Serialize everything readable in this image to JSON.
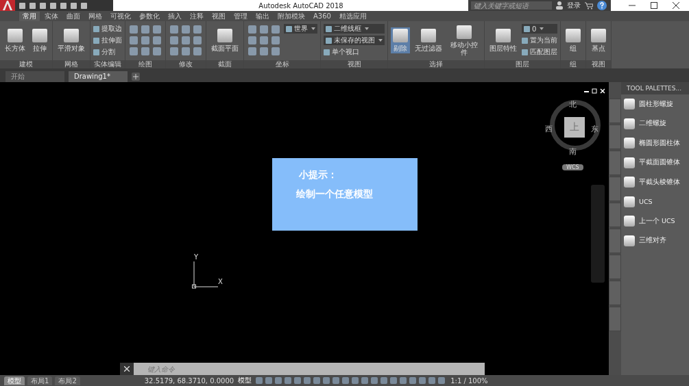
{
  "window": {
    "title": "Autodesk AutoCAD 2018",
    "search_placeholder": "键入关键字或短语",
    "login": "登录"
  },
  "ribbon_tabs": [
    {
      "label": "常用",
      "selected": true
    },
    {
      "label": "实体",
      "selected": false
    },
    {
      "label": "曲面",
      "selected": false
    },
    {
      "label": "网格",
      "selected": false
    },
    {
      "label": "可视化",
      "selected": false
    },
    {
      "label": "参数化",
      "selected": false
    },
    {
      "label": "插入",
      "selected": false
    },
    {
      "label": "注释",
      "selected": false
    },
    {
      "label": "视图",
      "selected": false
    },
    {
      "label": "管理",
      "selected": false
    },
    {
      "label": "输出",
      "selected": false
    },
    {
      "label": "附加模块",
      "selected": false
    },
    {
      "label": "A360",
      "selected": false
    },
    {
      "label": "精选应用",
      "selected": false
    }
  ],
  "ribbon_panels": [
    {
      "title": "建模",
      "items": [
        {
          "kind": "large",
          "label": "长方体"
        },
        {
          "kind": "large",
          "label": "拉伸"
        }
      ]
    },
    {
      "title": "网格",
      "items": [
        {
          "kind": "large",
          "label": "平滑对象"
        }
      ]
    },
    {
      "title": "实体编辑",
      "items": [
        {
          "kind": "small",
          "label": "提取边"
        },
        {
          "kind": "small",
          "label": "拉伸面"
        },
        {
          "kind": "small",
          "label": "分割"
        }
      ]
    },
    {
      "title": "绘图",
      "items": [
        {
          "kind": "grid"
        }
      ]
    },
    {
      "title": "修改",
      "items": [
        {
          "kind": "grid"
        }
      ]
    },
    {
      "title": "截面",
      "items": [
        {
          "kind": "large",
          "label": "截面平面"
        }
      ]
    },
    {
      "title": "坐标",
      "items": [
        {
          "kind": "grid"
        },
        {
          "kind": "dropdown",
          "label": "世界"
        }
      ]
    },
    {
      "title": "视图",
      "items": [
        {
          "kind": "dropdown",
          "label": "二维线框"
        },
        {
          "kind": "dropdown",
          "label": "未保存的视图"
        },
        {
          "kind": "small",
          "label": "单个视口"
        }
      ]
    },
    {
      "title": "选择",
      "items": [
        {
          "kind": "large",
          "label": "剔除",
          "active": true
        },
        {
          "kind": "large",
          "label": "无过滤器",
          "active": false
        },
        {
          "kind": "large",
          "label": "移动小控件",
          "active": false
        }
      ]
    },
    {
      "title": "图层",
      "items": [
        {
          "kind": "large",
          "label": "图层特性"
        },
        {
          "kind": "dropdown",
          "label": "0"
        },
        {
          "kind": "small",
          "label": "置为当前"
        },
        {
          "kind": "small",
          "label": "匹配图层"
        }
      ]
    },
    {
      "title": "组",
      "items": [
        {
          "kind": "large",
          "label": "组"
        }
      ]
    },
    {
      "title": "视图",
      "items": [
        {
          "kind": "large",
          "label": "基点"
        }
      ]
    }
  ],
  "file_tabs": [
    {
      "label": "开始",
      "selected": false
    },
    {
      "label": "Drawing1*",
      "selected": true
    }
  ],
  "viewcube": {
    "north": "北",
    "west": "西",
    "face": "上",
    "east": "东",
    "south": "南",
    "ucs_menu": "WCS"
  },
  "hint": {
    "title": "小提示：",
    "text": "绘制一个任意模型"
  },
  "ucs_icon": {
    "y": "Y",
    "x": "X"
  },
  "tool_palette": {
    "title": "TOOL PALETTES...",
    "items": [
      "圆柱形螺旋",
      "二维螺旋",
      "椭圆形圆柱体",
      "平截面圆锥体",
      "平截头棱锥体",
      "UCS",
      "上一个 UCS",
      "三维对齐"
    ]
  },
  "command_line": {
    "placeholder": "键入命令"
  },
  "layout_tabs": [
    {
      "label": "模型",
      "selected": true
    },
    {
      "label": "布局1",
      "selected": false
    },
    {
      "label": "布局2",
      "selected": false
    }
  ],
  "status_bar": {
    "coordinates": "32.5179, 68.3710, 0.0000",
    "space": "模型",
    "scale": "1:1 / 100%"
  }
}
